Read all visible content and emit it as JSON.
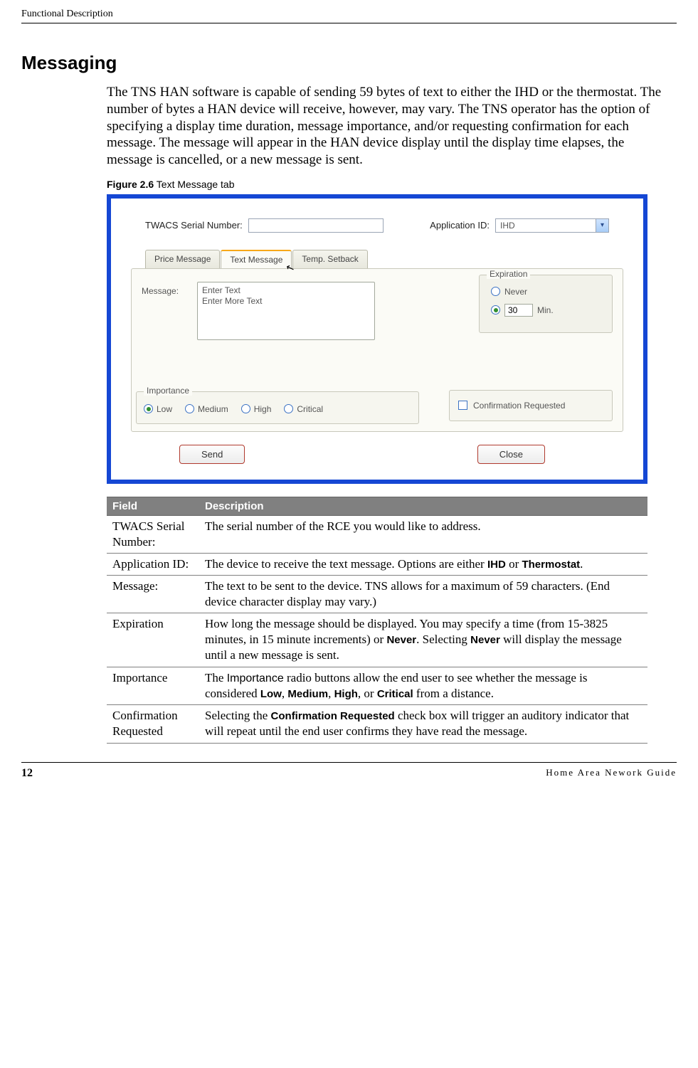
{
  "running_head": "Functional Description",
  "section_title": "Messaging",
  "intro": "The TNS HAN software is capable of sending 59 bytes of text to either the IHD or the thermostat.  The number of bytes a HAN device will receive, however, may vary. The TNS operator has the option of specifying a display time duration, message importance, and/or requesting confirmation for each message. The message will appear in the HAN device display until the display time elapses, the message is cancelled, or a new message is sent.",
  "figure": {
    "number": "Figure 2.6",
    "title": " Text Message tab"
  },
  "screenshot": {
    "serial_label": "TWACS Serial Number:",
    "serial_value": "",
    "appid_label": "Application ID:",
    "appid_value": "IHD",
    "tabs": {
      "price": "Price Message",
      "text": "Text Message",
      "temp": "Temp. Setback"
    },
    "message_label": "Message:",
    "message_line1": "Enter Text",
    "message_line2": "Enter More Text",
    "expiration_legend": "Expiration",
    "exp_never": "Never",
    "exp_min_value": "30",
    "exp_min_label": "Min.",
    "importance_legend": "Importance",
    "imp": {
      "low": "Low",
      "medium": "Medium",
      "high": "High",
      "critical": "Critical"
    },
    "confirm_label": "Confirmation Requested",
    "send": "Send",
    "close": "Close"
  },
  "table": {
    "h_field": "Field",
    "h_desc": "Description",
    "rows": {
      "r0": {
        "f": "TWACS Serial Number:",
        "d": "The serial number of the RCE you would like to address."
      },
      "r1": {
        "f": "Application ID:",
        "d_pre": "The device to receive the text message. Options are either ",
        "b1": "IHD",
        "d_mid": " or ",
        "b2": "Thermostat",
        "d_post": "."
      },
      "r2": {
        "f": "Message:",
        "d": "The text to be sent to the device. TNS allows for a maximum of 59 characters. (End device character display may vary.)"
      },
      "r3": {
        "f": "Expiration",
        "d_pre": "How long the message should be displayed. You may specify a time (from 15-3825 minutes, in 15 minute increments) or ",
        "b1": "Never",
        "d_mid": ". Selecting ",
        "b2": "Never",
        "d_post": " will display the message until a new message is sent."
      },
      "r4": {
        "f": "Importance",
        "d_pre": "The ",
        "ui": "Importance",
        "d_mid1": " radio buttons allow the end user to see whether the message is considered ",
        "b1": "Low",
        "c1": ", ",
        "b2": "Medium",
        "c2": ", ",
        "b3": "High",
        "c3": ", or ",
        "b4": "Critical",
        "d_post": " from a distance."
      },
      "r5": {
        "f": "Confirmation Requested",
        "d_pre": "Selecting the ",
        "b1": "Confirmation Requested",
        "d_post": " check box will trigger an auditory indicator that will repeat until the end user confirms they have read the message."
      }
    }
  },
  "footer": {
    "page": "12",
    "doc": "Home Area Nework Guide"
  }
}
